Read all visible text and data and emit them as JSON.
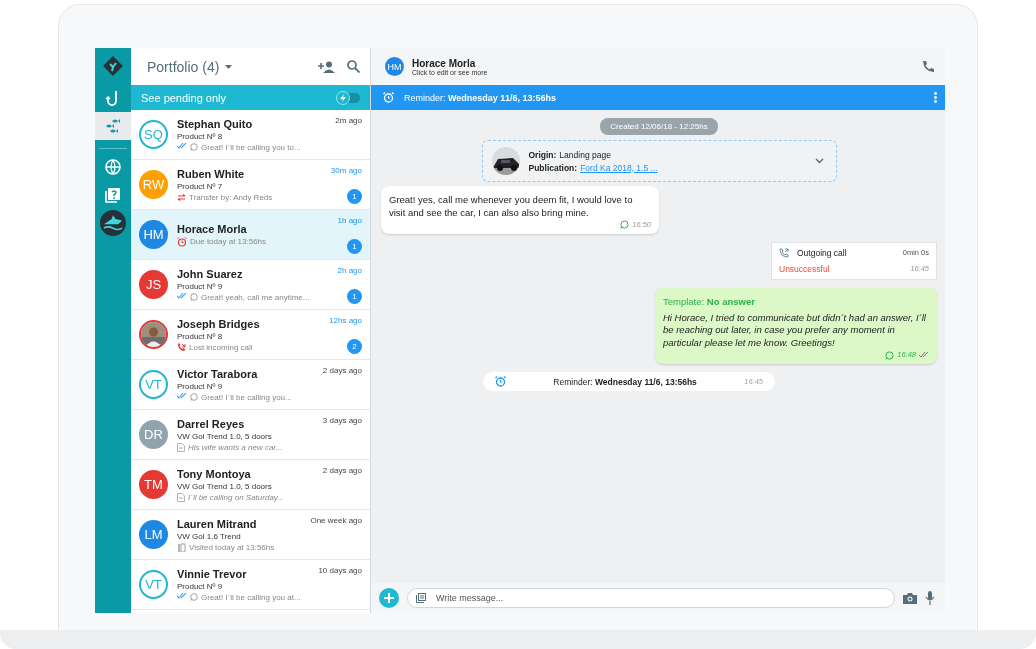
{
  "rail": [
    {
      "selected": false
    },
    {
      "selected": false
    },
    {
      "selected": true
    },
    {
      "selected": false
    },
    {
      "selected": false
    },
    {
      "selected": false
    }
  ],
  "list_header": {
    "title": "Portfolio (4)"
  },
  "pending_filter": {
    "label": "See pending only",
    "on": false
  },
  "contacts": [
    {
      "avatar": {
        "kind": "outline",
        "initials": "SQ",
        "color": "#1fb8cf"
      },
      "name": "Stephan Quito",
      "subtitle": "Product Nº 8",
      "preview": {
        "kind": "read",
        "text": "Great! I´ll be calling you to..."
      },
      "time": "2m ago",
      "unread": false,
      "selected": false
    },
    {
      "avatar": {
        "kind": "filled",
        "initials": "RW",
        "color": "#ffa000"
      },
      "name": "Ruben White",
      "subtitle": "Product Nº 7",
      "preview": {
        "kind": "transfer",
        "text": "Transfer by: Andy Reds"
      },
      "time": "30m ago",
      "unread": true,
      "badge": "1",
      "selected": false
    },
    {
      "avatar": {
        "kind": "filled",
        "initials": "HM",
        "color": "#1e88e5"
      },
      "name": "Horace Morla",
      "preview": {
        "kind": "alarm",
        "text": "Due today at 13:56hs"
      },
      "time": "1h ago",
      "unread": true,
      "badge": "1",
      "selected": true
    },
    {
      "avatar": {
        "kind": "filled",
        "initials": "JS",
        "color": "#e53935"
      },
      "name": "John Suarez",
      "subtitle": "Product Nº 9",
      "preview": {
        "kind": "read",
        "text": "Great! yeah, call me anytime..."
      },
      "time": "2h ago",
      "unread": true,
      "badge": "1",
      "selected": false
    },
    {
      "name": "Joseph Bridges",
      "subtitle": "Product Nº 8",
      "preview": {
        "kind": "missed",
        "text": "Lost incoming call"
      },
      "time": "12hs ago",
      "unread": true,
      "badge": "2",
      "selected": false
    },
    {
      "avatar": {
        "kind": "outline",
        "initials": "VT",
        "color": "#1fb8cf"
      },
      "name": "Victor Tarabora",
      "subtitle": "Product Nº 9",
      "preview": {
        "kind": "read",
        "text": "Great! I´ll be calling you..."
      },
      "time": "2 days ago",
      "unread": false,
      "selected": false
    },
    {
      "avatar": {
        "kind": "filled",
        "initials": "DR",
        "color": "#90a4ae"
      },
      "name": "Darrel Reyes",
      "subtitle": "VW Gol Trend 1.0, 5 doors",
      "preview": {
        "kind": "note",
        "text": "His wife wants a new car..."
      },
      "time": "3 days ago",
      "unread": false,
      "selected": false
    },
    {
      "avatar": {
        "kind": "filled",
        "initials": "TM",
        "color": "#e53935"
      },
      "name": "Tony Montoya",
      "subtitle": "VW Gol Trend 1.0, 5 doors",
      "preview": {
        "kind": "note",
        "text": "I´ll be calling on Saturday..."
      },
      "time": "2 days ago",
      "unread": false,
      "selected": false
    },
    {
      "avatar": {
        "kind": "filled",
        "initials": "LM",
        "color": "#1e88e5"
      },
      "name": "Lauren Mitrand",
      "subtitle": "VW Gol 1.6 Trend",
      "preview": {
        "kind": "visit",
        "text": "Visited today at 13:56hs"
      },
      "time": "One week ago",
      "unread": false,
      "selected": false
    },
    {
      "avatar": {
        "kind": "outline",
        "initials": "VT",
        "color": "#1fb8cf"
      },
      "name": "Vinnie Trevor",
      "subtitle": "Product Nº 9",
      "preview": {
        "kind": "read",
        "text": "Great! I´ll be calling you at..."
      },
      "time": "10 days  ago",
      "unread": false,
      "selected": false
    }
  ],
  "chat_header": {
    "initials": "HM",
    "name": "Horace Morla",
    "hint": "Click to edit or see more"
  },
  "reminder_bar": {
    "text": "Reminder: **Wednesday 11/6, 13:56hs**"
  },
  "messages": [
    {
      "kind": "chip",
      "text": "Created 12/06/18 - 12:25hs"
    },
    {
      "kind": "origin",
      "origin_label": "Origin:",
      "origin": "Landing page",
      "publication_label": "Publication:",
      "publication": "Ford Ka 2018, 1.5 ..."
    },
    {
      "kind": "incoming",
      "text": "Great! yes, call me whenever you deem fit, I would love to visit and see the car, I can also also bring mine.",
      "time": "16:50"
    },
    {
      "kind": "call",
      "title": "Outgoing call",
      "duration": "0min 0s",
      "result": "Unsuccessful",
      "time": "16:45"
    },
    {
      "kind": "template",
      "title": "Template: **No answer**",
      "text": "Hi Horace, I tried to communicate but didn´t had an answer, I´ll be reaching out later, in case you prefer any moment in particular please let me know. Greetings!",
      "time": "16:48"
    },
    {
      "kind": "reminder",
      "text": "Reminder: **Wednesday 11/6, 13:56hs**",
      "time": "16:45"
    }
  ],
  "composer": {
    "placeholder": "Write message..."
  }
}
